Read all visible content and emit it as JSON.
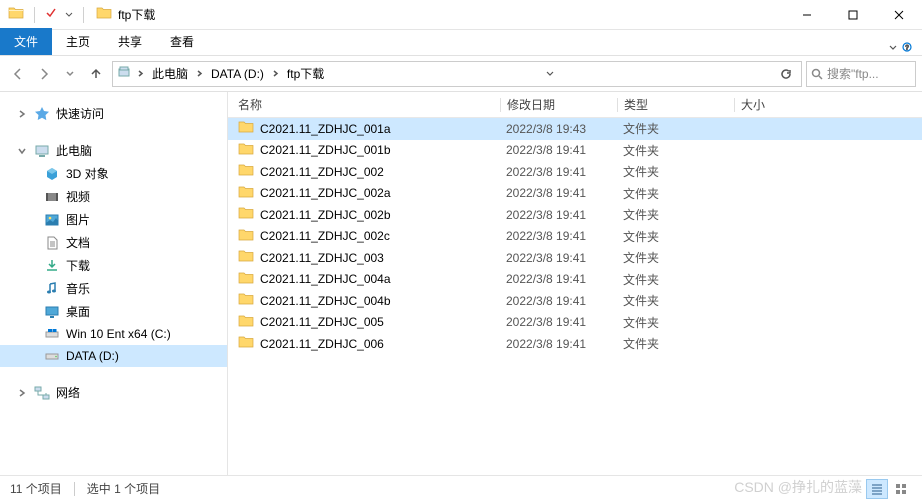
{
  "title": "ftp下载",
  "ribbon": {
    "tabs": {
      "file": "文件",
      "home": "主页",
      "share": "共享",
      "view": "查看"
    }
  },
  "breadcrumb": {
    "items": [
      "此电脑",
      "DATA (D:)",
      "ftp下载"
    ]
  },
  "search_placeholder": "搜索\"ftp...",
  "sidebar": {
    "quick_access": "快速访问",
    "this_pc": "此电脑",
    "items": [
      {
        "label": "3D 对象",
        "icon": "3d"
      },
      {
        "label": "视频",
        "icon": "video"
      },
      {
        "label": "图片",
        "icon": "pictures"
      },
      {
        "label": "文档",
        "icon": "documents"
      },
      {
        "label": "下载",
        "icon": "downloads"
      },
      {
        "label": "音乐",
        "icon": "music"
      },
      {
        "label": "桌面",
        "icon": "desktop"
      },
      {
        "label": "Win 10 Ent x64 (C:)",
        "icon": "drive-win"
      },
      {
        "label": "DATA (D:)",
        "icon": "drive"
      }
    ],
    "network": "网络"
  },
  "columns": {
    "name": "名称",
    "date": "修改日期",
    "type": "类型",
    "size": "大小"
  },
  "folder_type_label": "文件夹",
  "rows": [
    {
      "name": "C2021.11_ZDHJC_001a",
      "date": "2022/3/8 19:43",
      "selected": true
    },
    {
      "name": "C2021.11_ZDHJC_001b",
      "date": "2022/3/8 19:41"
    },
    {
      "name": "C2021.11_ZDHJC_002",
      "date": "2022/3/8 19:41"
    },
    {
      "name": "C2021.11_ZDHJC_002a",
      "date": "2022/3/8 19:41"
    },
    {
      "name": "C2021.11_ZDHJC_002b",
      "date": "2022/3/8 19:41"
    },
    {
      "name": "C2021.11_ZDHJC_002c",
      "date": "2022/3/8 19:41"
    },
    {
      "name": "C2021.11_ZDHJC_003",
      "date": "2022/3/8 19:41"
    },
    {
      "name": "C2021.11_ZDHJC_004a",
      "date": "2022/3/8 19:41"
    },
    {
      "name": "C2021.11_ZDHJC_004b",
      "date": "2022/3/8 19:41"
    },
    {
      "name": "C2021.11_ZDHJC_005",
      "date": "2022/3/8 19:41"
    },
    {
      "name": "C2021.11_ZDHJC_006",
      "date": "2022/3/8 19:41"
    }
  ],
  "status": {
    "count": "11 个项目",
    "selected": "选中 1 个项目"
  },
  "watermark": "CSDN @挣扎的蓝藻"
}
